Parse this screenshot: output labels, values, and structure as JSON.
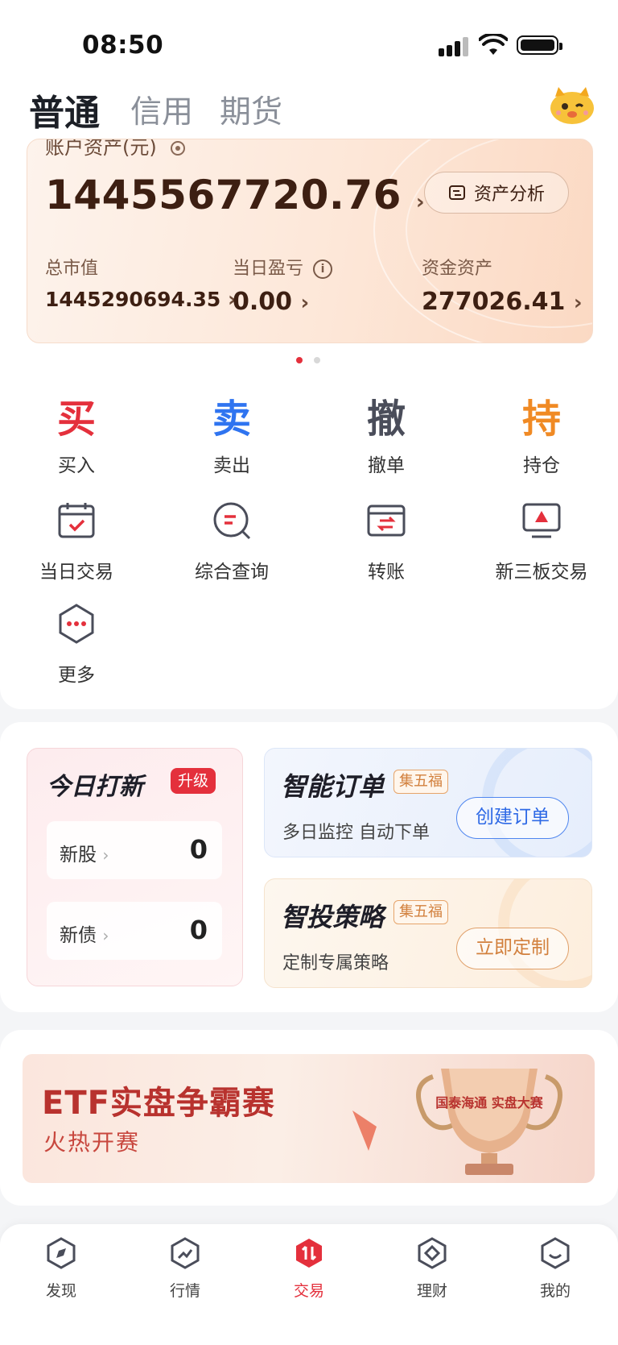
{
  "status_bar": {
    "time": "08:50"
  },
  "tabs": [
    {
      "label": "普通",
      "active": true
    },
    {
      "label": "信用",
      "active": false
    },
    {
      "label": "期货",
      "active": false
    }
  ],
  "account": {
    "label": "账户资产(元)",
    "total": "1445567720.76",
    "analysis_button": "资产分析",
    "market_value_label": "总市值",
    "market_value": "1445290694.35",
    "daily_pnl_label": "当日盈亏",
    "daily_pnl": "0.00",
    "cash_label": "资金资产",
    "cash": "277026.41"
  },
  "quick_actions": [
    {
      "glyph": "买",
      "label": "买入",
      "color": "#e4303c"
    },
    {
      "glyph": "卖",
      "label": "卖出",
      "color": "#2f74f0"
    },
    {
      "glyph": "撤",
      "label": "撤单",
      "color": "#4a4d5a"
    },
    {
      "glyph": "持",
      "label": "持仓",
      "color": "#f08a24"
    }
  ],
  "tools": [
    {
      "label": "当日交易",
      "icon": "calendar-check-icon"
    },
    {
      "label": "综合查询",
      "icon": "search-list-icon"
    },
    {
      "label": "转账",
      "icon": "transfer-card-icon"
    },
    {
      "label": "新三板交易",
      "icon": "monitor-icon"
    },
    {
      "label": "更多",
      "icon": "more-hexagon-icon"
    }
  ],
  "ipo": {
    "title": "今日打新",
    "badge": "升级",
    "rows": [
      {
        "label": "新股",
        "value": "0"
      },
      {
        "label": "新债",
        "value": "0"
      }
    ]
  },
  "smart_order": {
    "title": "智能订单",
    "tag": "集五福",
    "subtitle": "多日监控 自动下单",
    "button": "创建订单"
  },
  "strategy": {
    "title": "智投策略",
    "tag": "集五福",
    "subtitle": "定制专属策略",
    "button": "立即定制"
  },
  "banner": {
    "title": "ETF实盘争霸赛",
    "subtitle": "火热开赛",
    "trophy_text": "国泰海通 实盘大赛"
  },
  "bottom_nav": [
    {
      "label": "发现",
      "active": false
    },
    {
      "label": "行情",
      "active": false
    },
    {
      "label": "交易",
      "active": true
    },
    {
      "label": "理财",
      "active": false
    },
    {
      "label": "我的",
      "active": false
    }
  ],
  "colors": {
    "accent": "#e4303c",
    "blue": "#2f74f0",
    "orange": "#f08a24"
  }
}
